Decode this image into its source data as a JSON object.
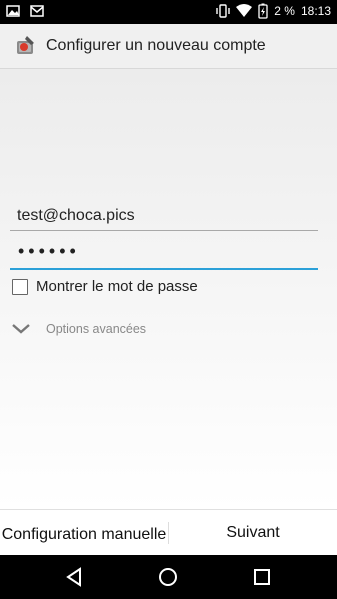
{
  "status_bar": {
    "battery_percent": "2 %",
    "time": "18:13",
    "left_icons": [
      "image-icon",
      "mail-icon"
    ],
    "right_icons": [
      "vibrate-icon",
      "wifi-icon",
      "battery-charging-icon"
    ]
  },
  "app_bar": {
    "title": "Configurer un nouveau compte",
    "icon": "app-logo-icon"
  },
  "form": {
    "email_value": "test@choca.pics",
    "password_mask": "••••••",
    "show_password_label": "Montrer le mot de passe",
    "show_password_checked": false,
    "advanced_options_label": "Options avancées"
  },
  "buttons": {
    "manual_label": "Configuration manuelle",
    "next_label": "Suivant"
  },
  "nav_bar": {
    "icons": [
      "back-icon",
      "home-icon",
      "recents-icon"
    ]
  },
  "colors": {
    "accent": "#2ba0d8",
    "status_bar": "#000000",
    "app_bar": "#f0f0f0"
  }
}
